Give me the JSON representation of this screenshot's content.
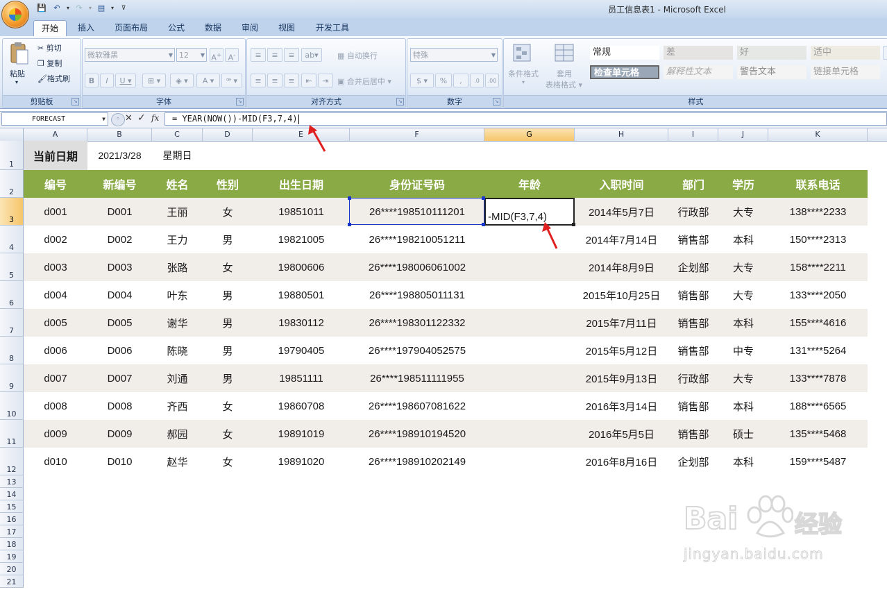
{
  "window": {
    "title": "员工信息表1 - Microsoft Excel"
  },
  "quick_access": [
    "save-icon",
    "undo-icon",
    "redo-icon",
    "print-preview-icon",
    "customize-icon"
  ],
  "ribbon": {
    "tabs": [
      "开始",
      "插入",
      "页面布局",
      "公式",
      "数据",
      "审阅",
      "视图",
      "开发工具"
    ],
    "active_tab": "开始",
    "clipboard": {
      "label": "剪贴板",
      "paste": "粘贴",
      "cut": "剪切",
      "copy": "复制",
      "format_painter": "格式刷"
    },
    "font": {
      "label": "字体",
      "font_name": "微软雅黑",
      "font_size": "12"
    },
    "alignment": {
      "label": "对齐方式",
      "wrap": "自动换行",
      "merge": "合并后居中"
    },
    "number": {
      "label": "数字",
      "format": "特殊"
    },
    "styles": {
      "label": "样式",
      "conditional": "条件格式",
      "table_format_1": "套用",
      "table_format_2": "表格格式",
      "cells": [
        "常规",
        "差",
        "好",
        "适中",
        "检查单元格",
        "解释性文本",
        "警告文本",
        "链接单元格"
      ]
    }
  },
  "formula_bar": {
    "name_box": "FORECAST",
    "fx": "fx",
    "formula": "= YEAR(NOW())-MID(F3,7,4)"
  },
  "columns": [
    "A",
    "B",
    "C",
    "D",
    "E",
    "F",
    "G",
    "H",
    "I",
    "J",
    "K"
  ],
  "rows": [
    "1",
    "2",
    "3",
    "4",
    "5",
    "6",
    "7",
    "8",
    "9",
    "10",
    "11",
    "12",
    "13",
    "14",
    "15",
    "16",
    "17",
    "18",
    "19",
    "20",
    "21"
  ],
  "sheet": {
    "current_date_label": "当前日期",
    "current_date": "2021/3/28",
    "weekday": "星期日",
    "headers": [
      "编号",
      "新编号",
      "姓名",
      "性别",
      "出生日期",
      "身份证号码",
      "年龄",
      "入职时间",
      "部门",
      "学历",
      "联系电话"
    ],
    "data": [
      [
        "d001",
        "D001",
        "王丽",
        "女",
        "19851011",
        "26****198510111201",
        "-MID(F3,7,4)",
        "2014年5月7日",
        "行政部",
        "大专",
        "138****2233"
      ],
      [
        "d002",
        "D002",
        "王力",
        "男",
        "19821005",
        "26****198210051211",
        "",
        "2014年7月14日",
        "销售部",
        "本科",
        "150****2313"
      ],
      [
        "d003",
        "D003",
        "张路",
        "女",
        "19800606",
        "26****198006061002",
        "",
        "2014年8月9日",
        "企划部",
        "大专",
        "158****2211"
      ],
      [
        "d004",
        "D004",
        "叶东",
        "男",
        "19880501",
        "26****198805011131",
        "",
        "2015年10月25日",
        "销售部",
        "大专",
        "133****2050"
      ],
      [
        "d005",
        "D005",
        "谢华",
        "男",
        "19830112",
        "26****198301122332",
        "",
        "2015年7月11日",
        "销售部",
        "本科",
        "155****4616"
      ],
      [
        "d006",
        "D006",
        "陈晓",
        "男",
        "19790405",
        "26****197904052575",
        "",
        "2015年5月12日",
        "销售部",
        "中专",
        "131****5264"
      ],
      [
        "d007",
        "D007",
        "刘通",
        "男",
        "19851111",
        "26****198511111955",
        "",
        "2015年9月13日",
        "行政部",
        "大专",
        "133****7878"
      ],
      [
        "d008",
        "D008",
        "齐西",
        "女",
        "19860708",
        "26****198607081622",
        "",
        "2016年3月14日",
        "销售部",
        "本科",
        "188****6565"
      ],
      [
        "d009",
        "D009",
        "郝园",
        "女",
        "19891019",
        "26****198910194520",
        "",
        "2016年5月5日",
        "销售部",
        "硕士",
        "135****5468"
      ],
      [
        "d010",
        "D010",
        "赵华",
        "女",
        "19891020",
        "26****198910202149",
        "",
        "2016年8月16日",
        "企划部",
        "本科",
        "159****5487"
      ]
    ]
  },
  "watermark": {
    "brand": "Bai",
    "brand2": "经验",
    "url": "jingyan.baidu.com"
  },
  "colors": {
    "header_band": "#8aaa46",
    "zebra": "#f1eeea",
    "date_label_bg": "#dedede",
    "selection": "#1a36c8"
  }
}
